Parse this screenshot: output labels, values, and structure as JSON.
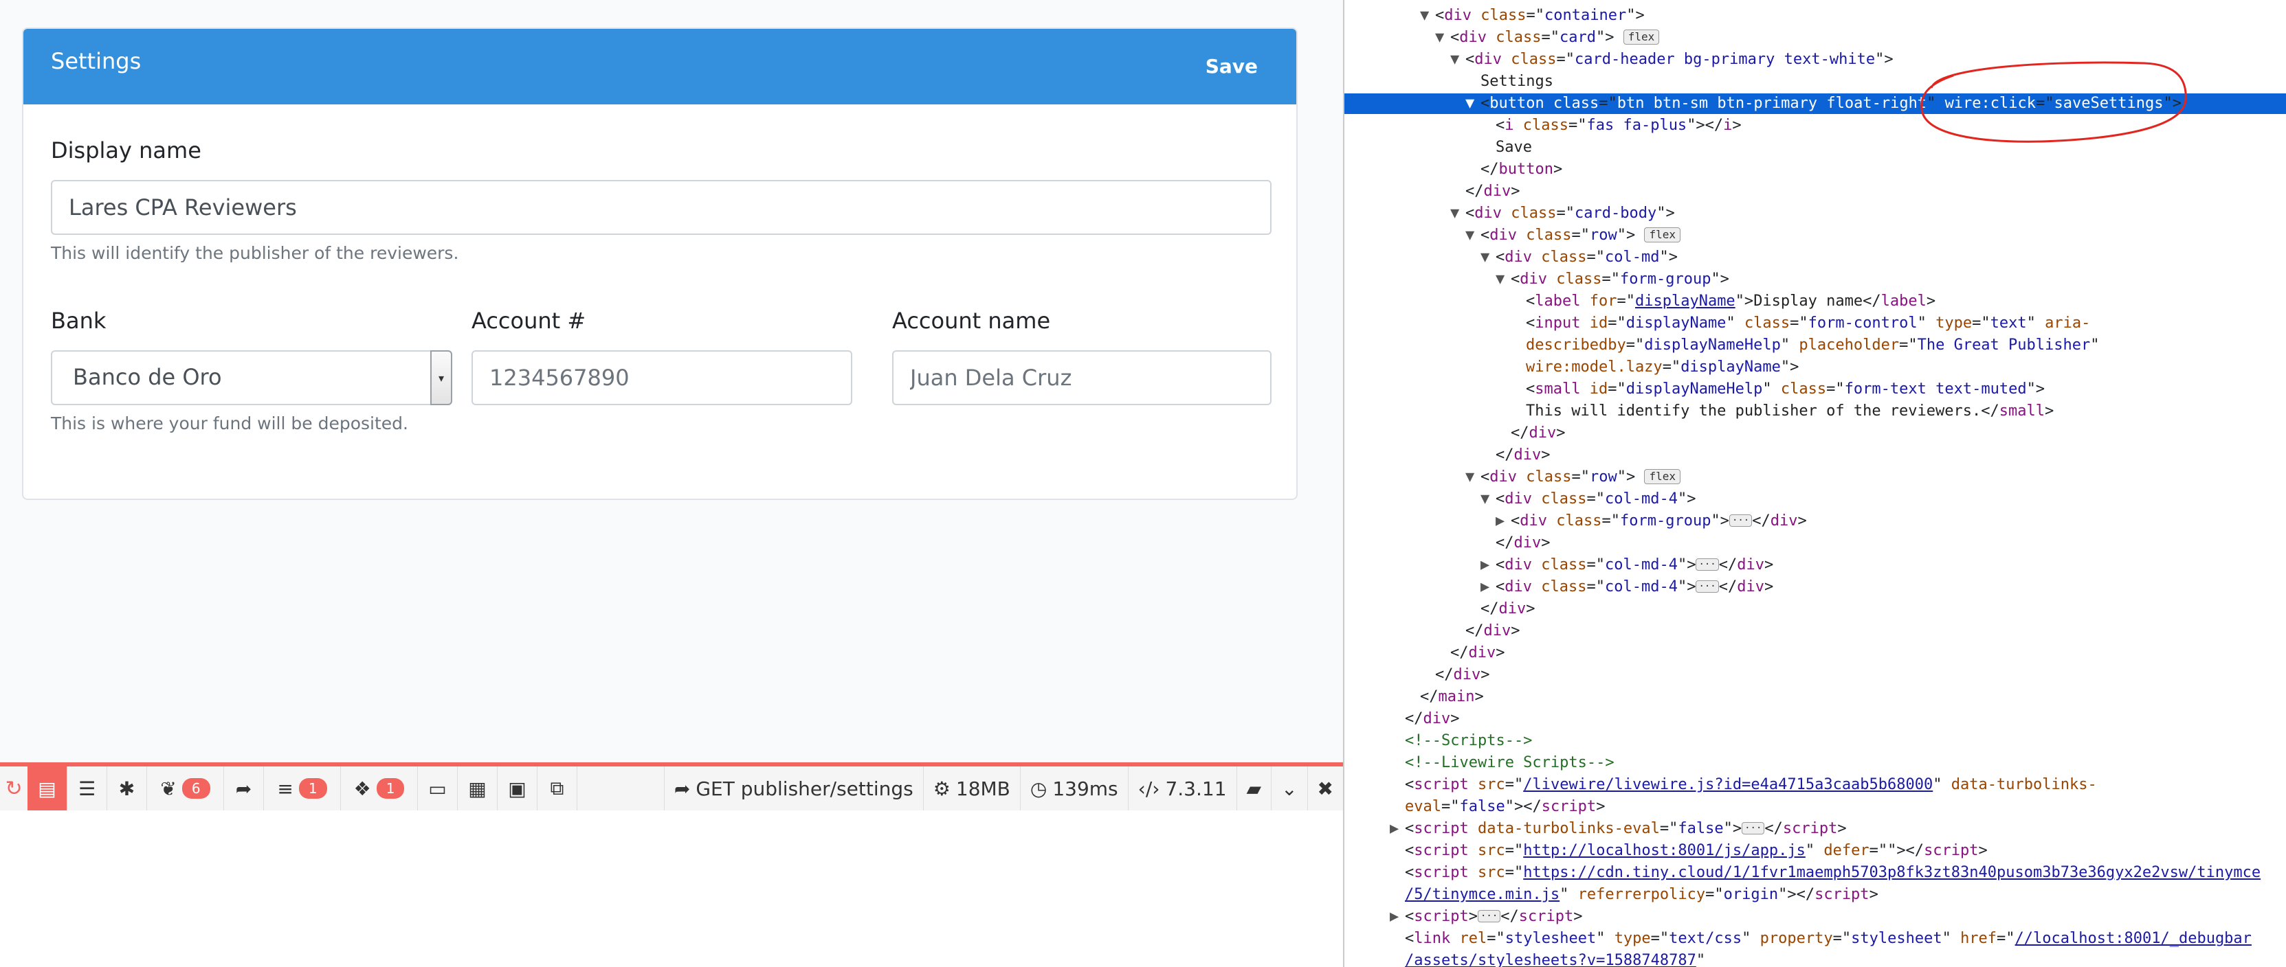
{
  "card": {
    "title": "Settings",
    "save_label": "Save",
    "display_name_label": "Display name",
    "display_name_value": "Lares CPA Reviewers",
    "display_name_help": "This will identify the publisher of the reviewers.",
    "bank_label": "Bank",
    "bank_value": "Banco de Oro",
    "bank_help": "This is where your fund will be deposited.",
    "account_number_label": "Account #",
    "account_number_placeholder": "1234567890",
    "account_name_label": "Account name",
    "account_name_placeholder": "Juan Dela Cruz"
  },
  "debugbar": {
    "badges": {
      "views": "6",
      "queries": "1",
      "models": "1"
    },
    "route": "GET publisher/settings",
    "memory": "18MB",
    "time": "139ms",
    "php_version": "7.3.11",
    "accent": "#f4645f"
  },
  "devtools": {
    "lines": [
      {
        "indent": 4,
        "tri": "open",
        "html": "&lt;<span class='tag'>div</span> <span class='attr'>class</span>=\"<span class='val'>container</span>\"&gt;"
      },
      {
        "indent": 5,
        "tri": "open",
        "html": "&lt;<span class='tag'>div</span> <span class='attr'>class</span>=\"<span class='val'>card</span>\"&gt; <span class='pill'>flex</span>"
      },
      {
        "indent": 6,
        "tri": "open",
        "html": "&lt;<span class='tag'>div</span> <span class='attr'>class</span>=\"<span class='val'>card-header bg-primary text-white</span>\"&gt;"
      },
      {
        "indent": 7,
        "tri": "none",
        "html": "<span class='txt'>Settings</span>"
      },
      {
        "indent": 7,
        "tri": "open",
        "selected": true,
        "html": "&lt;<span class='tag'>button</span> <span class='attr'>class</span>=\"<span class='val'>btn btn-sm btn-primary float-right</span>\" <span class='attr'>wire:click</span>=\"<span class='val'>saveSettings</span>\"&gt;"
      },
      {
        "indent": 8,
        "tri": "none",
        "html": "&lt;<span class='tag'>i</span> <span class='attr'>class</span>=\"<span class='val'>fas fa-plus</span>\"&gt;&lt;/<span class='tag'>i</span>&gt;"
      },
      {
        "indent": 8,
        "tri": "none",
        "html": "<span class='txt'>Save</span>"
      },
      {
        "indent": 7,
        "tri": "none",
        "html": "&lt;/<span class='tag'>button</span>&gt;"
      },
      {
        "indent": 6,
        "tri": "none",
        "html": "&lt;/<span class='tag'>div</span>&gt;"
      },
      {
        "indent": 6,
        "tri": "open",
        "html": "&lt;<span class='tag'>div</span> <span class='attr'>class</span>=\"<span class='val'>card-body</span>\"&gt;"
      },
      {
        "indent": 7,
        "tri": "open",
        "html": "&lt;<span class='tag'>div</span> <span class='attr'>class</span>=\"<span class='val'>row</span>\"&gt; <span class='pill'>flex</span>"
      },
      {
        "indent": 8,
        "tri": "open",
        "html": "&lt;<span class='tag'>div</span> <span class='attr'>class</span>=\"<span class='val'>col-md</span>\"&gt;"
      },
      {
        "indent": 9,
        "tri": "open",
        "html": "&lt;<span class='tag'>div</span> <span class='attr'>class</span>=\"<span class='val'>form-group</span>\"&gt;"
      },
      {
        "indent": 10,
        "tri": "none",
        "html": "&lt;<span class='tag'>label</span> <span class='attr'>for</span>=\"<span class='val' style='text-decoration:underline'>displayName</span>\"&gt;<span class='txt'>Display name</span>&lt;/<span class='tag'>label</span>&gt;"
      },
      {
        "indent": 10,
        "tri": "none",
        "html": "&lt;<span class='tag'>input</span> <span class='attr'>id</span>=\"<span class='val'>displayName</span>\" <span class='attr'>class</span>=\"<span class='val'>form-control</span>\" <span class='attr'>type</span>=\"<span class='val'>text</span>\" <span class='attr'>aria-</span>"
      },
      {
        "indent": 10,
        "tri": "none",
        "html": "<span class='attr'>describedby</span>=\"<span class='val'>displayNameHelp</span>\" <span class='attr'>placeholder</span>=\"<span class='val'>The Great Publisher</span>\""
      },
      {
        "indent": 10,
        "tri": "none",
        "html": "<span class='attr'>wire:model.lazy</span>=\"<span class='val'>displayName</span>\"&gt;"
      },
      {
        "indent": 10,
        "tri": "none",
        "html": "&lt;<span class='tag'>small</span> <span class='attr'>id</span>=\"<span class='val'>displayNameHelp</span>\" <span class='attr'>class</span>=\"<span class='val'>form-text text-muted</span>\"&gt;"
      },
      {
        "indent": 10,
        "tri": "none",
        "html": "<span class='txt'>This will identify the publisher of the reviewers.</span>&lt;/<span class='tag'>small</span>&gt;"
      },
      {
        "indent": 9,
        "tri": "none",
        "html": "&lt;/<span class='tag'>div</span>&gt;"
      },
      {
        "indent": 8,
        "tri": "none",
        "html": "&lt;/<span class='tag'>div</span>&gt;"
      },
      {
        "indent": 7,
        "tri": "open",
        "html": "&lt;<span class='tag'>div</span> <span class='attr'>class</span>=\"<span class='val'>row</span>\"&gt; <span class='pill'>flex</span>"
      },
      {
        "indent": 8,
        "tri": "open",
        "html": "&lt;<span class='tag'>div</span> <span class='attr'>class</span>=\"<span class='val'>col-md-4</span>\"&gt;"
      },
      {
        "indent": 9,
        "tri": "closed",
        "html": "&lt;<span class='tag'>div</span> <span class='attr'>class</span>=\"<span class='val'>form-group</span>\"&gt;<span class='ellip'>···</span>&lt;/<span class='tag'>div</span>&gt;"
      },
      {
        "indent": 8,
        "tri": "none",
        "html": "&lt;/<span class='tag'>div</span>&gt;"
      },
      {
        "indent": 8,
        "tri": "closed",
        "html": "&lt;<span class='tag'>div</span> <span class='attr'>class</span>=\"<span class='val'>col-md-4</span>\"&gt;<span class='ellip'>···</span>&lt;/<span class='tag'>div</span>&gt;"
      },
      {
        "indent": 8,
        "tri": "closed",
        "html": "&lt;<span class='tag'>div</span> <span class='attr'>class</span>=\"<span class='val'>col-md-4</span>\"&gt;<span class='ellip'>···</span>&lt;/<span class='tag'>div</span>&gt;"
      },
      {
        "indent": 7,
        "tri": "none",
        "html": "&lt;/<span class='tag'>div</span>&gt;"
      },
      {
        "indent": 6,
        "tri": "none",
        "html": "&lt;/<span class='tag'>div</span>&gt;"
      },
      {
        "indent": 5,
        "tri": "none",
        "html": "&lt;/<span class='tag'>div</span>&gt;"
      },
      {
        "indent": 4,
        "tri": "none",
        "html": "&lt;/<span class='tag'>div</span>&gt;"
      },
      {
        "indent": 3,
        "tri": "none",
        "html": "&lt;/<span class='tag'>main</span>&gt;"
      },
      {
        "indent": 2,
        "tri": "none",
        "html": "&lt;/<span class='tag'>div</span>&gt;"
      },
      {
        "indent": 2,
        "tri": "none",
        "html": "<span class='cmt'>&lt;!--Scripts--&gt;</span>"
      },
      {
        "indent": 2,
        "tri": "none",
        "html": "<span class='cmt'>&lt;!--Livewire Scripts--&gt;</span>"
      },
      {
        "indent": 2,
        "tri": "none",
        "html": "&lt;<span class='tag'>script</span> <span class='attr'>src</span>=\"<span class='link'>/livewire/livewire.js?id=e4a4715a3caab5b68000</span>\" <span class='attr'>data-turbolinks-</span>"
      },
      {
        "indent": 2,
        "tri": "none",
        "html": "<span class='attr'>eval</span>=\"<span class='val'>false</span>\"&gt;&lt;/<span class='tag'>script</span>&gt;"
      },
      {
        "indent": 2,
        "tri": "closed",
        "html": "&lt;<span class='tag'>script</span> <span class='attr'>data-turbolinks-eval</span>=\"<span class='val'>false</span>\"&gt;<span class='ellip'>···</span>&lt;/<span class='tag'>script</span>&gt;"
      },
      {
        "indent": 2,
        "tri": "none",
        "html": "&lt;<span class='tag'>script</span> <span class='attr'>src</span>=\"<span class='link'>http://localhost:8001/js/app.js</span>\" <span class='attr'>defer</span>=\"\"&gt;&lt;/<span class='tag'>script</span>&gt;"
      },
      {
        "indent": 2,
        "tri": "none",
        "html": "&lt;<span class='tag'>script</span> <span class='attr'>src</span>=\"<span class='link'>https://cdn.tiny.cloud/1/1fvr1maemph5703p8fk3zt83n40pusom3b73e36gyx2e2vsw/tinymce</span>"
      },
      {
        "indent": 2,
        "tri": "none",
        "html": "<span class='link'>/5/tinymce.min.js</span>\" <span class='attr'>referrerpolicy</span>=\"<span class='val'>origin</span>\"&gt;&lt;/<span class='tag'>script</span>&gt;"
      },
      {
        "indent": 2,
        "tri": "closed",
        "html": "&lt;<span class='tag'>script</span>&gt;<span class='ellip'>···</span>&lt;/<span class='tag'>script</span>&gt;"
      },
      {
        "indent": 2,
        "tri": "none",
        "html": "&lt;<span class='tag'>link</span> <span class='attr'>rel</span>=\"<span class='val'>stylesheet</span>\" <span class='attr'>type</span>=\"<span class='val'>text/css</span>\" <span class='attr'>property</span>=\"<span class='val'>stylesheet</span>\" <span class='attr'>href</span>=\"<span class='link'>//localhost:8001/_debugbar</span>"
      },
      {
        "indent": 2,
        "tri": "none",
        "html": "<span class='link'>/assets/stylesheets?v=1588748787</span>\""
      }
    ]
  }
}
